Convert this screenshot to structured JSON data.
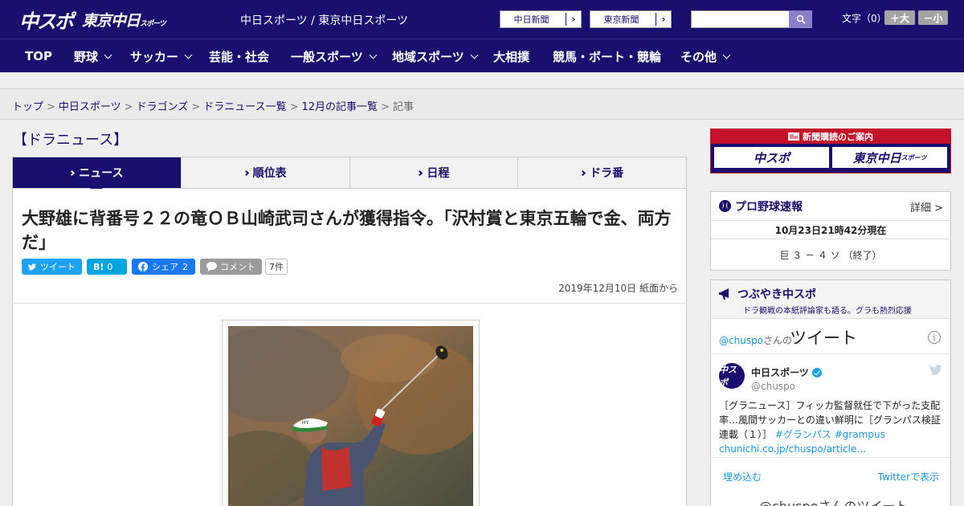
{
  "header": {
    "logo_main": "中スポ",
    "logo_sub": "東京中日",
    "logo_sub_small": "スポーツ",
    "site_name": "中日スポーツ / 東京中日スポーツ",
    "paper_links": [
      "中日新聞",
      "東京新聞"
    ],
    "font_size_label": "文字（0）",
    "font_larger": "＋大",
    "font_smaller": "－小",
    "search_placeholder": ""
  },
  "nav": {
    "items": [
      {
        "label": "TOP",
        "dropdown": false
      },
      {
        "label": "野球",
        "dropdown": true
      },
      {
        "label": "サッカー",
        "dropdown": true
      },
      {
        "label": "芸能・社会",
        "dropdown": false
      },
      {
        "label": "一般スポーツ",
        "dropdown": true
      },
      {
        "label": "地域スポーツ",
        "dropdown": true
      },
      {
        "label": "大相撲",
        "dropdown": false
      },
      {
        "label": "競馬・ボート・競輪",
        "dropdown": false
      },
      {
        "label": "その他",
        "dropdown": true
      }
    ]
  },
  "breadcrumb": {
    "links": [
      "トップ",
      "中日スポーツ",
      "ドラゴンズ",
      "ドラニュース一覧",
      "12月の記事一覧"
    ],
    "current": "記事",
    "separator": ">"
  },
  "section": {
    "title": "【ドラニュース】",
    "tabs": [
      "ニュース",
      "順位表",
      "日程",
      "ドラ番"
    ],
    "active_tab": 0
  },
  "article": {
    "headline": "大野雄に背番号２２の竜ＯＢ山崎武司さんが獲得指令。「沢村賞と東京五輪で金、両方だ」",
    "share": {
      "tweet": "ツイート",
      "hatena_icon": "B!",
      "hatena_count": "0",
      "facebook": "シェア",
      "facebook_count": "2",
      "comment": "コメント",
      "comment_count": "7件"
    },
    "dateline": "2019年12月10日 紙面から"
  },
  "sidebar": {
    "subscribe": {
      "title": "新聞購読のご案内",
      "logo_left": "中スポ",
      "logo_right": "東京中日",
      "logo_right_small": "スポーツ"
    },
    "baseball": {
      "title": "プロ野球速報",
      "detail": "詳細 >",
      "time": "10月23日21時42分現在",
      "score": "巨 ３ － ４ ソ （終了）"
    },
    "tweets": {
      "title": "つぶやき中スポ",
      "subtitle": "ドラ観戦の本紙評論家も語る。グラも熱烈応援",
      "timeline_user": "@chuspo",
      "timeline_user_suffix": "さんの",
      "timeline_label": "ツイート",
      "tweet": {
        "avatar_text": "中スポ",
        "name": "中日スポーツ",
        "handle": "@chuspo",
        "text": "［グラニュース］フィッカ監督就任で下がった支配率…風間サッカーとの違い鮮明に［グランパス検証連載（１）］",
        "hashtags": "#グランパス #grampus",
        "link": "chunichi.co.jp/chuspo/article…"
      },
      "embed": "埋め込む",
      "view_on_twitter": "Twitterで表示",
      "more": "@chuspoさんのツイート"
    }
  },
  "colors": {
    "brand_navy": "#1a0e6e",
    "accent_red": "#c4122b",
    "twitter_blue": "#1da1f2",
    "facebook_blue": "#1877f2",
    "hatena_blue": "#00a4de"
  },
  "icons": [
    "search-icon",
    "twitter-icon",
    "hatena-icon",
    "facebook-icon",
    "comment-icon",
    "baseball-icon",
    "megaphone-icon",
    "info-icon",
    "verified-icon",
    "twitter-bird-icon",
    "newspaper-icon",
    "chevron-down-icon",
    "chevron-right-icon"
  ]
}
